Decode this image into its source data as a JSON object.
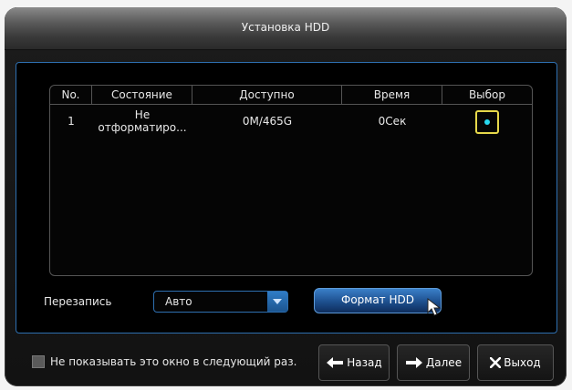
{
  "window": {
    "title": "Установка HDD"
  },
  "table": {
    "headers": [
      "No.",
      "Состояние",
      "Доступно",
      "Время",
      "Выбор"
    ],
    "rows": [
      {
        "no": "1",
        "status_line1": "Не",
        "status_line2": "отформатиро...",
        "available": "0M/465G",
        "time": "0Сек",
        "selected": true
      }
    ]
  },
  "overwrite": {
    "label": "Перезапись",
    "value": "Авто"
  },
  "format_button": {
    "label": "Формат HDD"
  },
  "footer": {
    "dont_show_label": "Не показывать это окно в следующий раз.",
    "dont_show_checked": false,
    "back_label": "Назад",
    "next_label": "Далее",
    "exit_label": "Выход"
  },
  "colors": {
    "accent_blue": "#2e6fb0",
    "select_border": "#e6d84a",
    "select_dot": "#27d9f0"
  }
}
